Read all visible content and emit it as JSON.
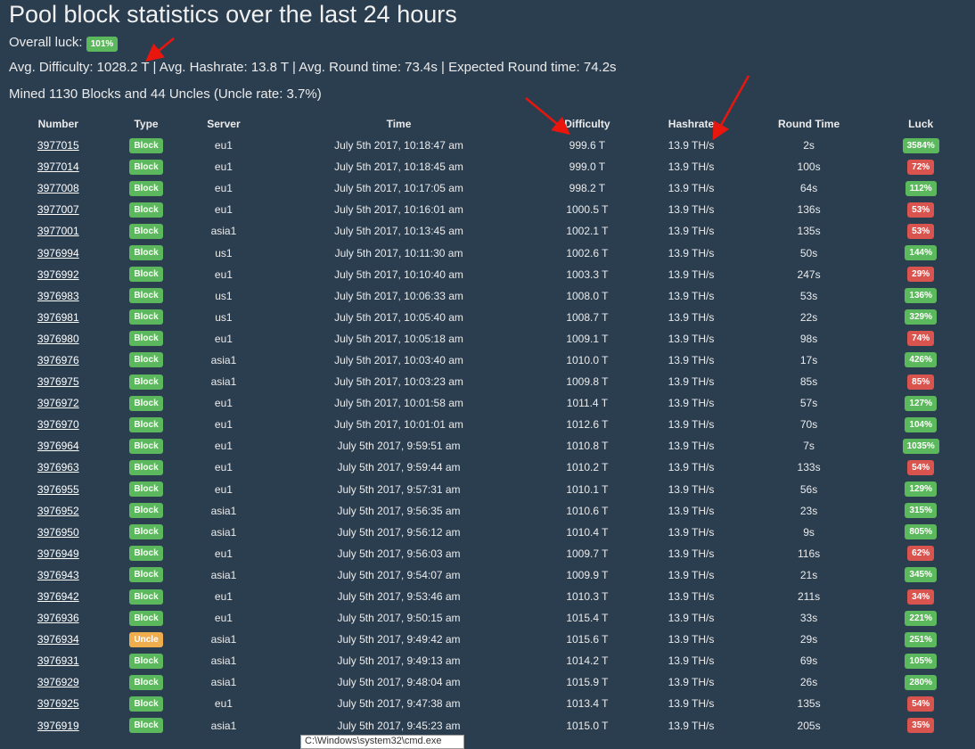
{
  "title": "Pool block statistics over the last 24 hours",
  "overall_luck_label": "Overall luck:",
  "overall_luck": "101%",
  "averages": "Avg. Difficulty: 1028.2 T | Avg. Hashrate: 13.8 T | Avg. Round time: 73.4s | Expected Round time: 74.2s",
  "mined": "Mined 1130 Blocks and 44 Uncles (Uncle rate: 3.7%)",
  "colors": {
    "green": "#5cb85c",
    "red": "#d9534f",
    "orange": "#f0ad4e",
    "bg": "#2b3e50"
  },
  "headers": [
    "Number",
    "Type",
    "Server",
    "Time",
    "Difficulty",
    "Hashrate",
    "Round Time",
    "Luck"
  ],
  "rows": [
    [
      "3977015",
      "Block",
      "eu1",
      "July 5th 2017, 10:18:47 am",
      "999.6 T",
      "13.9 TH/s",
      "2s",
      "3584%",
      "g"
    ],
    [
      "3977014",
      "Block",
      "eu1",
      "July 5th 2017, 10:18:45 am",
      "999.0 T",
      "13.9 TH/s",
      "100s",
      "72%",
      "r"
    ],
    [
      "3977008",
      "Block",
      "eu1",
      "July 5th 2017, 10:17:05 am",
      "998.2 T",
      "13.9 TH/s",
      "64s",
      "112%",
      "g"
    ],
    [
      "3977007",
      "Block",
      "eu1",
      "July 5th 2017, 10:16:01 am",
      "1000.5 T",
      "13.9 TH/s",
      "136s",
      "53%",
      "r"
    ],
    [
      "3977001",
      "Block",
      "asia1",
      "July 5th 2017, 10:13:45 am",
      "1002.1 T",
      "13.9 TH/s",
      "135s",
      "53%",
      "r"
    ],
    [
      "3976994",
      "Block",
      "us1",
      "July 5th 2017, 10:11:30 am",
      "1002.6 T",
      "13.9 TH/s",
      "50s",
      "144%",
      "g"
    ],
    [
      "3976992",
      "Block",
      "eu1",
      "July 5th 2017, 10:10:40 am",
      "1003.3 T",
      "13.9 TH/s",
      "247s",
      "29%",
      "r"
    ],
    [
      "3976983",
      "Block",
      "us1",
      "July 5th 2017, 10:06:33 am",
      "1008.0 T",
      "13.9 TH/s",
      "53s",
      "136%",
      "g"
    ],
    [
      "3976981",
      "Block",
      "us1",
      "July 5th 2017, 10:05:40 am",
      "1008.7 T",
      "13.9 TH/s",
      "22s",
      "329%",
      "g"
    ],
    [
      "3976980",
      "Block",
      "eu1",
      "July 5th 2017, 10:05:18 am",
      "1009.1 T",
      "13.9 TH/s",
      "98s",
      "74%",
      "r"
    ],
    [
      "3976976",
      "Block",
      "asia1",
      "July 5th 2017, 10:03:40 am",
      "1010.0 T",
      "13.9 TH/s",
      "17s",
      "426%",
      "g"
    ],
    [
      "3976975",
      "Block",
      "asia1",
      "July 5th 2017, 10:03:23 am",
      "1009.8 T",
      "13.9 TH/s",
      "85s",
      "85%",
      "r"
    ],
    [
      "3976972",
      "Block",
      "eu1",
      "July 5th 2017, 10:01:58 am",
      "1011.4 T",
      "13.9 TH/s",
      "57s",
      "127%",
      "g"
    ],
    [
      "3976970",
      "Block",
      "eu1",
      "July 5th 2017, 10:01:01 am",
      "1012.6 T",
      "13.9 TH/s",
      "70s",
      "104%",
      "g"
    ],
    [
      "3976964",
      "Block",
      "eu1",
      "July 5th 2017, 9:59:51 am",
      "1010.8 T",
      "13.9 TH/s",
      "7s",
      "1035%",
      "g"
    ],
    [
      "3976963",
      "Block",
      "eu1",
      "July 5th 2017, 9:59:44 am",
      "1010.2 T",
      "13.9 TH/s",
      "133s",
      "54%",
      "r"
    ],
    [
      "3976955",
      "Block",
      "eu1",
      "July 5th 2017, 9:57:31 am",
      "1010.1 T",
      "13.9 TH/s",
      "56s",
      "129%",
      "g"
    ],
    [
      "3976952",
      "Block",
      "asia1",
      "July 5th 2017, 9:56:35 am",
      "1010.6 T",
      "13.9 TH/s",
      "23s",
      "315%",
      "g"
    ],
    [
      "3976950",
      "Block",
      "asia1",
      "July 5th 2017, 9:56:12 am",
      "1010.4 T",
      "13.9 TH/s",
      "9s",
      "805%",
      "g"
    ],
    [
      "3976949",
      "Block",
      "eu1",
      "July 5th 2017, 9:56:03 am",
      "1009.7 T",
      "13.9 TH/s",
      "116s",
      "62%",
      "r"
    ],
    [
      "3976943",
      "Block",
      "asia1",
      "July 5th 2017, 9:54:07 am",
      "1009.9 T",
      "13.9 TH/s",
      "21s",
      "345%",
      "g"
    ],
    [
      "3976942",
      "Block",
      "eu1",
      "July 5th 2017, 9:53:46 am",
      "1010.3 T",
      "13.9 TH/s",
      "211s",
      "34%",
      "r"
    ],
    [
      "3976936",
      "Block",
      "eu1",
      "July 5th 2017, 9:50:15 am",
      "1015.4 T",
      "13.9 TH/s",
      "33s",
      "221%",
      "g"
    ],
    [
      "3976934",
      "Uncle",
      "asia1",
      "July 5th 2017, 9:49:42 am",
      "1015.6 T",
      "13.9 TH/s",
      "29s",
      "251%",
      "g"
    ],
    [
      "3976931",
      "Block",
      "asia1",
      "July 5th 2017, 9:49:13 am",
      "1014.2 T",
      "13.9 TH/s",
      "69s",
      "105%",
      "g"
    ],
    [
      "3976929",
      "Block",
      "asia1",
      "July 5th 2017, 9:48:04 am",
      "1015.9 T",
      "13.9 TH/s",
      "26s",
      "280%",
      "g"
    ],
    [
      "3976925",
      "Block",
      "eu1",
      "July 5th 2017, 9:47:38 am",
      "1013.4 T",
      "13.9 TH/s",
      "135s",
      "54%",
      "r"
    ],
    [
      "3976919",
      "Block",
      "asia1",
      "July 5th 2017, 9:45:23 am",
      "1015.0 T",
      "13.9 TH/s",
      "205s",
      "35%",
      "r"
    ]
  ],
  "tooltip": "C:\\Windows\\system32\\cmd.exe"
}
